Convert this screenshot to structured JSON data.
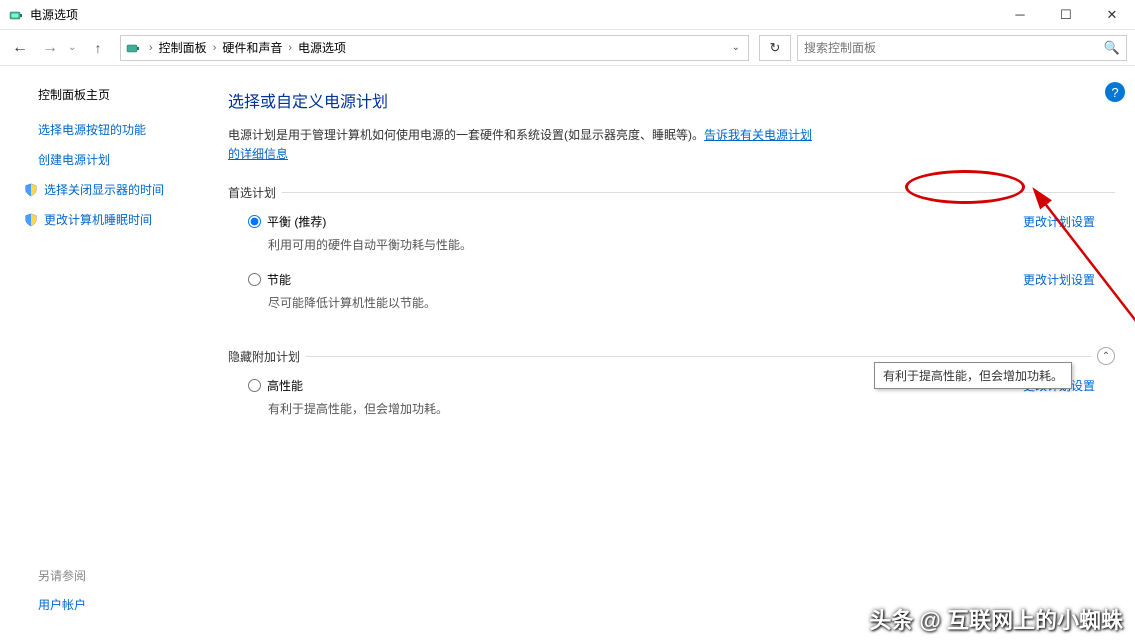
{
  "window": {
    "title": "电源选项"
  },
  "breadcrumb": {
    "items": [
      "控制面板",
      "硬件和声音",
      "电源选项"
    ]
  },
  "search": {
    "placeholder": "搜索控制面板"
  },
  "sidebar": {
    "home": "控制面板主页",
    "links": [
      "选择电源按钮的功能",
      "创建电源计划",
      "选择关闭显示器的时间",
      "更改计算机睡眠时间"
    ],
    "footer_head": "另请参阅",
    "footer_link": "用户帐户"
  },
  "main": {
    "title": "选择或自定义电源计划",
    "desc_pre": "电源计划是用于管理计算机如何使用电源的一套硬件和系统设置(如显示器亮度、睡眠等)。",
    "desc_link": "告诉我有关电源计划的详细信息",
    "section_preferred": "首选计划",
    "section_hidden": "隐藏附加计划",
    "plans": {
      "balanced": {
        "name": "平衡 (推荐)",
        "desc": "利用可用的硬件自动平衡功耗与性能。",
        "link": "更改计划设置"
      },
      "saver": {
        "name": "节能",
        "desc": "尽可能降低计算机性能以节能。",
        "link": "更改计划设置"
      },
      "high": {
        "name": "高性能",
        "desc": "有利于提高性能，但会增加功耗。",
        "link": "更改计划设置"
      }
    },
    "tooltip": "有利于提高性能，但会增加功耗。"
  },
  "watermark": "头条 @ 互联网上的小蜘蛛"
}
